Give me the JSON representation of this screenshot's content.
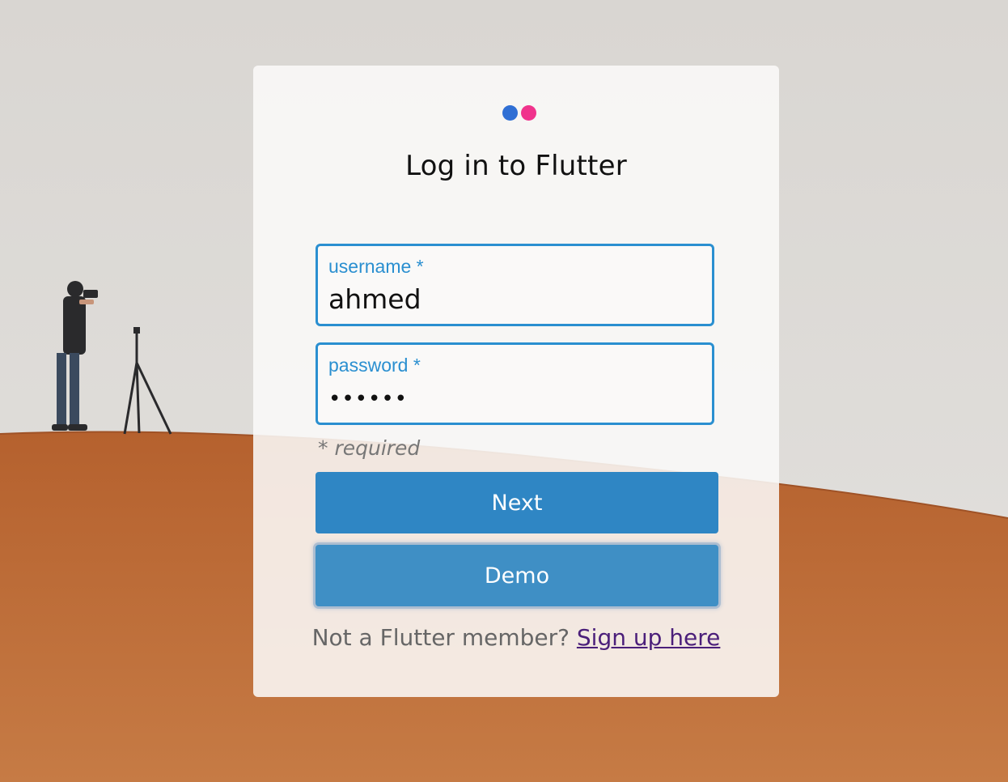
{
  "colors": {
    "accent": "#2a8fd0",
    "next_button": "#2f86c4",
    "demo_button": "#3f8fc5",
    "logo_blue": "#2f6fd4",
    "logo_pink": "#f0338c",
    "link": "#4b1f7a"
  },
  "logo": {
    "icon": "flutter-dots-logo"
  },
  "title": "Log in to Flutter",
  "username": {
    "label": "username *",
    "value": "ahmed"
  },
  "password": {
    "label": "password *",
    "value": "••••••"
  },
  "required_note": "* required",
  "buttons": {
    "next": "Next",
    "demo": "Demo"
  },
  "signup": {
    "prompt": "Not a Flutter member? ",
    "link": "Sign up here"
  }
}
